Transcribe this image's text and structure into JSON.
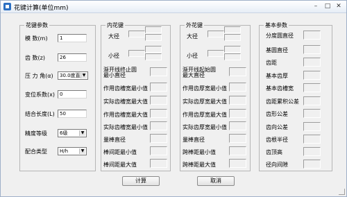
{
  "window": {
    "title": "花键计算(单位mm)",
    "min": "–",
    "max": "□",
    "close": "✕"
  },
  "spline_params": {
    "title": "花键参数",
    "fields": [
      {
        "label": "模    数(m)",
        "value": "1"
      },
      {
        "label": "齿    数(z)",
        "value": "26"
      },
      {
        "label": "压 力 角(α)",
        "value": "30.0度直齿"
      },
      {
        "label": "变位系数(x)",
        "value": "0"
      },
      {
        "label": "结合长度(L)",
        "value": "50"
      },
      {
        "label": "精度等级",
        "value": "6级"
      },
      {
        "label": "配合类型",
        "value": "H/h"
      }
    ]
  },
  "internal": {
    "title": "内花键",
    "major_label": "大径",
    "minor_label": "小径",
    "items": [
      "渐开线终止圆\n最小直径",
      "作用齿槽宽最小值",
      "实际齿槽宽最大值",
      "作用齿槽宽最大值",
      "实际齿槽宽最小值",
      "量棒直径",
      "棒间距最小值",
      "棒间距最大值"
    ]
  },
  "external": {
    "title": "外花键",
    "major_label": "大径",
    "minor_label": "小径",
    "items": [
      "渐开线起始圆\n最大直径",
      "作用齿厚宽最小值",
      "实际齿厚宽最大值",
      "作用齿厚宽最大值",
      "实际齿厚宽最小值",
      "量棒直径",
      "跨棒距最小值",
      "跨棒距最大值"
    ]
  },
  "basic": {
    "title": "基本参数",
    "items": [
      "分度圆直径",
      "基圆直径",
      "齿距",
      "基本齿厚",
      "基本齿槽宽",
      "齿距累积公差",
      "齿形公差",
      "齿向公差",
      "齿根半径",
      "齿顶高",
      "径向间隙"
    ]
  },
  "buttons": {
    "calc": "计算",
    "cancel": "取消"
  }
}
